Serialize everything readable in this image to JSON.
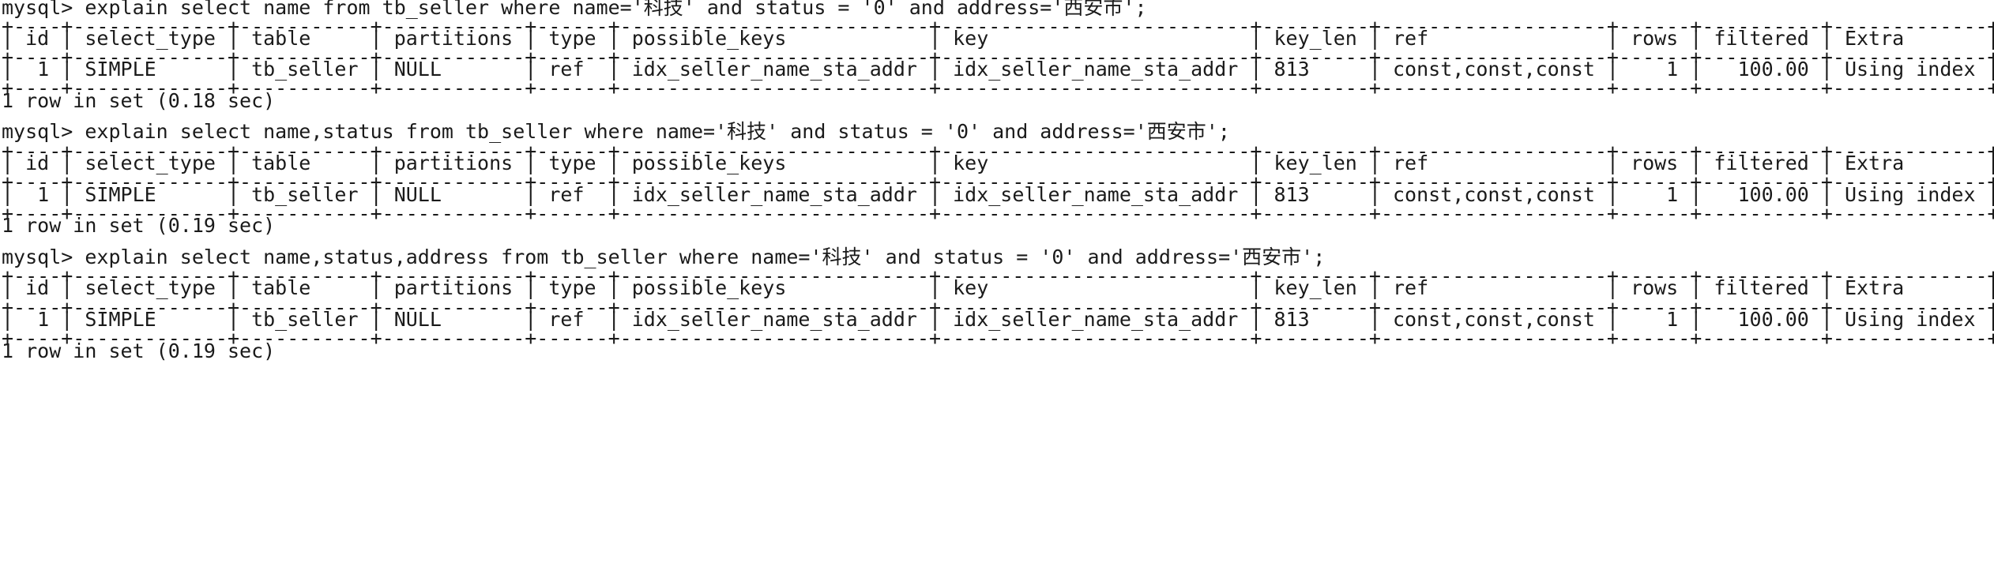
{
  "terminal": {
    "blocks": [
      {
        "command": "mysql> explain select name from tb_seller where name='科技' and status = '0' and address='西安市';",
        "border": "+----+-------------+-----------+------------+------+--------------------------+--------------------------+---------+-------------------+------+----------+-------------+",
        "header": "| id | select_type | table     | partitions | type | possible_keys            | key                      | key_len | ref               | rows | filtered | Extra       |",
        "row": "|  1 | SIMPLE      | tb_seller | NULL       | ref  | idx_seller_name_sta_addr | idx_seller_name_sta_addr | 813     | const,const,const |    1 |   100.00 | Using index |",
        "status": "1 row in set (0.18 sec)"
      },
      {
        "command": "mysql> explain select name,status from tb_seller where name='科技' and status = '0' and address='西安市';",
        "border": "+----+-------------+-----------+------------+------+--------------------------+--------------------------+---------+-------------------+------+----------+-------------+",
        "header": "| id | select_type | table     | partitions | type | possible_keys            | key                      | key_len | ref               | rows | filtered | Extra       |",
        "row": "|  1 | SIMPLE      | tb_seller | NULL       | ref  | idx_seller_name_sta_addr | idx_seller_name_sta_addr | 813     | const,const,const |    1 |   100.00 | Using index |",
        "status": "1 row in set (0.19 sec)"
      },
      {
        "command": "mysql> explain select name,status,address from tb_seller where name='科技' and status = '0' and address='西安市';",
        "border": "+----+-------------+-----------+------------+------+--------------------------+--------------------------+---------+-------------------+------+----------+-------------+",
        "header": "| id | select_type | table     | partitions | type | possible_keys            | key                      | key_len | ref               | rows | filtered | Extra       |",
        "row": "|  1 | SIMPLE      | tb_seller | NULL       | ref  | idx_seller_name_sta_addr | idx_seller_name_sta_addr | 813     | const,const,const |    1 |   100.00 | Using index |",
        "status": "1 row in set (0.19 sec)"
      }
    ]
  }
}
